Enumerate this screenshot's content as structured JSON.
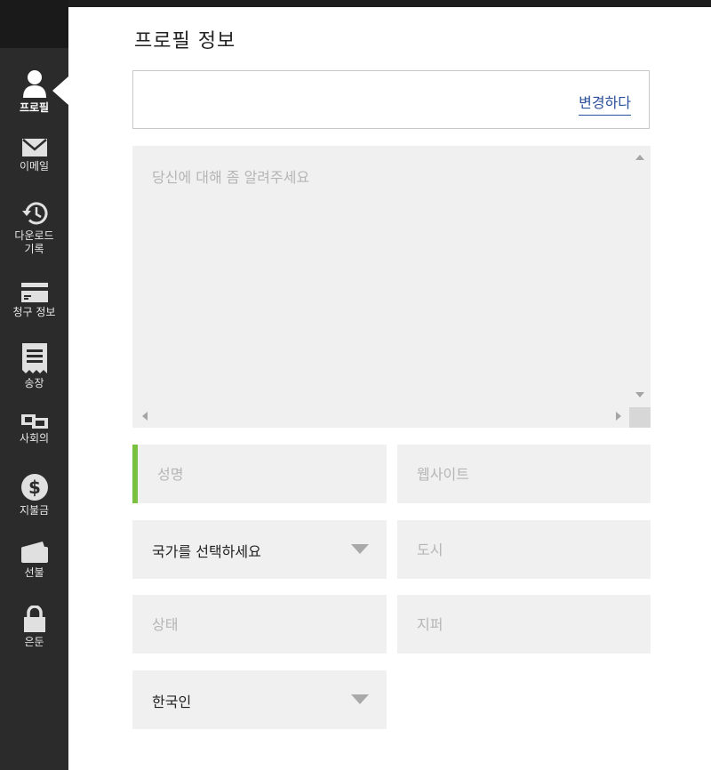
{
  "sidebar": {
    "items": [
      {
        "label": "프로필",
        "icon": "user-icon",
        "active": true
      },
      {
        "label": "이메일",
        "icon": "envelope-icon"
      },
      {
        "label": "다운로드\n기록",
        "icon": "history-icon"
      },
      {
        "label": "청구 정보",
        "icon": "credit-card-icon"
      },
      {
        "label": "송장",
        "icon": "receipt-icon"
      },
      {
        "label": "사회의",
        "icon": "social-icon"
      },
      {
        "label": "지불금",
        "icon": "dollar-icon"
      },
      {
        "label": "선불",
        "icon": "wallet-icon"
      },
      {
        "label": "은둔",
        "icon": "lock-icon"
      }
    ]
  },
  "main": {
    "title": "프로필 정보",
    "change_link": "변경하다",
    "bio_placeholder": "당신에 대해 좀 알려주세요",
    "fields": {
      "name_placeholder": "성명",
      "website_placeholder": "웹사이트",
      "country_select": "국가를 선택하세요",
      "city_placeholder": "도시",
      "state_placeholder": "상태",
      "zip_placeholder": "지퍼",
      "nationality_select": "한국인"
    }
  },
  "colors": {
    "sidebar_bg": "#2b2b2b",
    "accent_green": "#7ac142",
    "link_blue": "#2b4f9a",
    "field_bg": "#f0f0f0"
  }
}
